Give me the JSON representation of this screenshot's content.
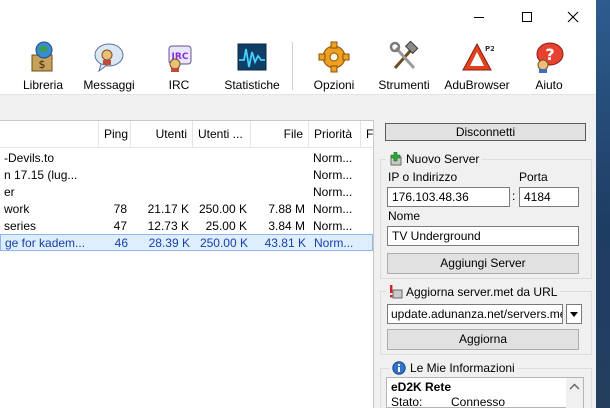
{
  "toolbar": {
    "items": [
      {
        "label": "Libreria",
        "icon": "library-icon"
      },
      {
        "label": "Messaggi",
        "icon": "messages-icon"
      },
      {
        "label": "IRC",
        "icon": "irc-icon"
      },
      {
        "label": "Statistiche",
        "icon": "statistics-icon"
      },
      {
        "label": "Opzioni",
        "icon": "options-gear-icon"
      },
      {
        "label": "Strumenti",
        "icon": "tools-icon"
      },
      {
        "label": "AduBrowser",
        "icon": "adubrowser-icon"
      },
      {
        "label": "Aiuto",
        "icon": "help-icon"
      }
    ]
  },
  "server_list": {
    "columns": [
      "Ping",
      "Utenti",
      "Utenti ...",
      "File",
      "Priorità",
      "F"
    ],
    "rows": [
      {
        "name": "-Devils.to",
        "ping": "",
        "users": "",
        "max_users": "",
        "files": "",
        "priority": "Norm..."
      },
      {
        "name": "n 17.15 (lug...",
        "ping": "",
        "users": "",
        "max_users": "",
        "files": "",
        "priority": "Norm..."
      },
      {
        "name": "er",
        "ping": "",
        "users": "",
        "max_users": "",
        "files": "",
        "priority": "Norm..."
      },
      {
        "name": "work",
        "ping": "78",
        "users": "21.17 K",
        "max_users": "250.00 K",
        "files": "7.88 M",
        "priority": "Norm..."
      },
      {
        "name": "series",
        "ping": "47",
        "users": "12.73 K",
        "max_users": "25.00 K",
        "files": "3.84 M",
        "priority": "Norm..."
      },
      {
        "name": "ge for kadem...",
        "ping": "46",
        "users": "28.39 K",
        "max_users": "250.00 K",
        "files": "43.81 K",
        "priority": "Norm..."
      }
    ]
  },
  "panel": {
    "disconnect_label": "Disconnetti",
    "new_server": {
      "title": "Nuovo Server",
      "ip_label": "IP o Indirizzo",
      "ip_value": "176.103.48.36",
      "port_label": "Porta",
      "port_value": "4184",
      "colon": ":",
      "name_label": "Nome",
      "name_value": "TV Underground",
      "add_label": "Aggiungi Server"
    },
    "update": {
      "title": "Aggiorna server.met da URL",
      "url_value": "update.adunanza.net/servers.met",
      "update_label": "Aggiorna"
    },
    "my_info": {
      "title": "Le Mie Informazioni",
      "section": "eD2K Rete",
      "status_label": "Stato:",
      "status_value": "Connesso"
    }
  },
  "colors": {
    "selection_text": "#1a3ea8",
    "selection_bg": "#ddeeff"
  }
}
